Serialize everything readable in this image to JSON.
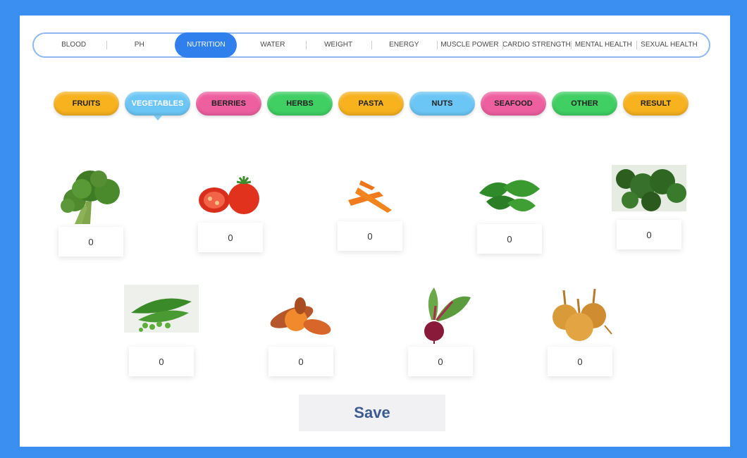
{
  "top_tabs": [
    {
      "label": "BLOOD"
    },
    {
      "label": "PH"
    },
    {
      "label": "NUTRITION",
      "active": true
    },
    {
      "label": "WATER"
    },
    {
      "label": "WEIGHT"
    },
    {
      "label": "ENERGY"
    },
    {
      "label": "MUSCLE POWER"
    },
    {
      "label": "CARDIO STRENGTH"
    },
    {
      "label": "MENTAL HEALTH"
    },
    {
      "label": "SEXUAL HEALTH"
    }
  ],
  "categories": [
    {
      "label": "FRUITS",
      "color": "#f7b21e"
    },
    {
      "label": "VEGETABLES",
      "color": "#6cc6f5",
      "active": true
    },
    {
      "label": "BERRIES",
      "color": "#ee5fa0"
    },
    {
      "label": "HERBS",
      "color": "#3fcf63"
    },
    {
      "label": "PASTA",
      "color": "#f7b21e"
    },
    {
      "label": "NUTS",
      "color": "#6cc6f5"
    },
    {
      "label": "SEAFOOD",
      "color": "#ee5fa0"
    },
    {
      "label": "OTHER",
      "color": "#3fcf63"
    },
    {
      "label": "RESULT",
      "color": "#f7b21e"
    }
  ],
  "vegetables": [
    {
      "icon": "broccoli-icon",
      "value": "0"
    },
    {
      "icon": "tomato-icon",
      "value": "0"
    },
    {
      "icon": "carrot-icon",
      "value": "0"
    },
    {
      "icon": "spinach-icon",
      "value": "0"
    },
    {
      "icon": "kale-icon",
      "value": "0"
    },
    {
      "icon": "peas-icon",
      "value": "0"
    },
    {
      "icon": "sweet-potato-icon",
      "value": "0"
    },
    {
      "icon": "beet-icon",
      "value": "0"
    },
    {
      "icon": "onion-icon",
      "value": "0"
    }
  ],
  "save_label": "Save"
}
